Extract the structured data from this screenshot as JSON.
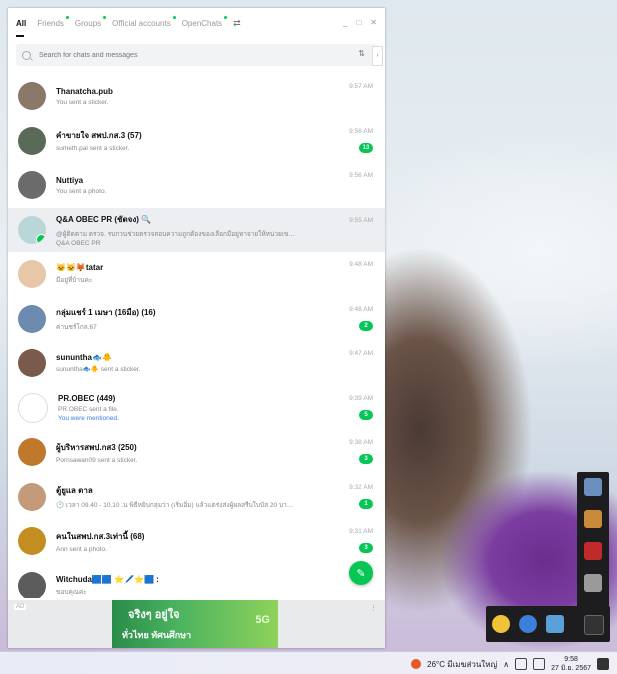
{
  "tabs": [
    {
      "label": "All",
      "active": true,
      "dot": false
    },
    {
      "label": "Friends",
      "active": false,
      "dot": true
    },
    {
      "label": "Groups",
      "active": false,
      "dot": true
    },
    {
      "label": "Official accounts",
      "active": false,
      "dot": true
    },
    {
      "label": "OpenChats",
      "active": false,
      "dot": true
    }
  ],
  "window_controls": {
    "minimize": "_",
    "maximize": "□",
    "close": "✕"
  },
  "search": {
    "placeholder": "Search for chats and messages"
  },
  "chats": [
    {
      "name": "Thanatcha.pub",
      "message": "You sent a sticker.",
      "time": "9:57 AM",
      "unread": "",
      "mention": "",
      "avatar_color": "#8a7868"
    },
    {
      "name": "คำขายใจ สพป.กส.3 (57)",
      "message": "sumeth.pal sent a sticker.",
      "time": "9:56 AM",
      "unread": "13",
      "mention": "",
      "avatar_color": "#5a6a58"
    },
    {
      "name": "Nuttiya",
      "message": "You sent a photo.",
      "time": "9:56 AM",
      "unread": "",
      "mention": "",
      "avatar_color": "#6b6b6b"
    },
    {
      "name": "Q&A OBEC PR (ชัดจง) 🔍",
      "message": "@ผู้ติดตาม ตรวจ. รบกวนช่วยตรวจสอบความถูกต้องของเลือกมีอยู่หาจายให้หน่วยเขตเพ",
      "message2": "Q&A OBEC PR",
      "time": "9:55 AM",
      "unread": "",
      "mention": "",
      "avatar_color": "#b9d7d8",
      "selected": true
    },
    {
      "name": "🐱🐱🦊tatar",
      "message": "มีอยู่ที่บ้านคะ",
      "time": "9:48 AM",
      "unread": "",
      "mention": "",
      "avatar_color": "#e8c6a8"
    },
    {
      "name": "กลุ่มแชร์ 1 เมษา (16มือ) (16)",
      "message": "ค่านชร์โกล.67",
      "time": "9:48 AM",
      "unread": "2",
      "mention": "",
      "avatar_color": "#6d8bb0"
    },
    {
      "name": "sununtha🐟🐥",
      "message": "sununtha🐟🐥 sent a sticker.",
      "time": "9:47 AM",
      "unread": "",
      "mention": "",
      "avatar_color": "#7a5a4a"
    },
    {
      "name": "PR.OBEC (449)",
      "message": "PR.OBEC sent a file.",
      "time": "9:39 AM",
      "unread": "5",
      "mention": "You were mentioned.",
      "avatar_color": "#ffffff"
    },
    {
      "name": "ผู้บริหารสพป.กส3 (250)",
      "message": "Pornsawan09 sent a sticker.",
      "time": "9:38 AM",
      "unread": "3",
      "mention": "",
      "avatar_color": "#c0782c"
    },
    {
      "name": "ตู้ยูแล ตาล",
      "message": "🕐 เวลา 09.40 - 10.10 .น พิธีหยิบกลุ่มว่า  (เริ่มอิ่ม) แล้วแตร่งส่งผู้ผลสรีบใบบัส 20 บาท ทับกัคิด 🍅",
      "time": "9:32 AM",
      "unread": "1",
      "mention": "",
      "avatar_color": "#c49a7a"
    },
    {
      "name": "คนในสพป.กส.3เท่านี้ (68)",
      "message": "Ann sent a photo.",
      "time": "9:31 AM",
      "unread": "3",
      "mention": "",
      "avatar_color": "#c38d22"
    },
    {
      "name": "Witchuda🟦🟦 ⭐🖊️⭐🟦 :",
      "message": "ขอบคุณค่ะ",
      "time": "",
      "unread": "",
      "mention": "",
      "avatar_color": "#5c5c5c"
    }
  ],
  "ad": {
    "label": "AD",
    "slogan": "จริงๆ อยู่ใจ",
    "sub": "ทั่วไทย ทัศนศึกษา",
    "badge": "5G"
  },
  "taskbar": {
    "weather": "26°C มีเมฆส่วนใหญ่",
    "time": "9:58",
    "date": "27 มิ.ย. 2567"
  }
}
